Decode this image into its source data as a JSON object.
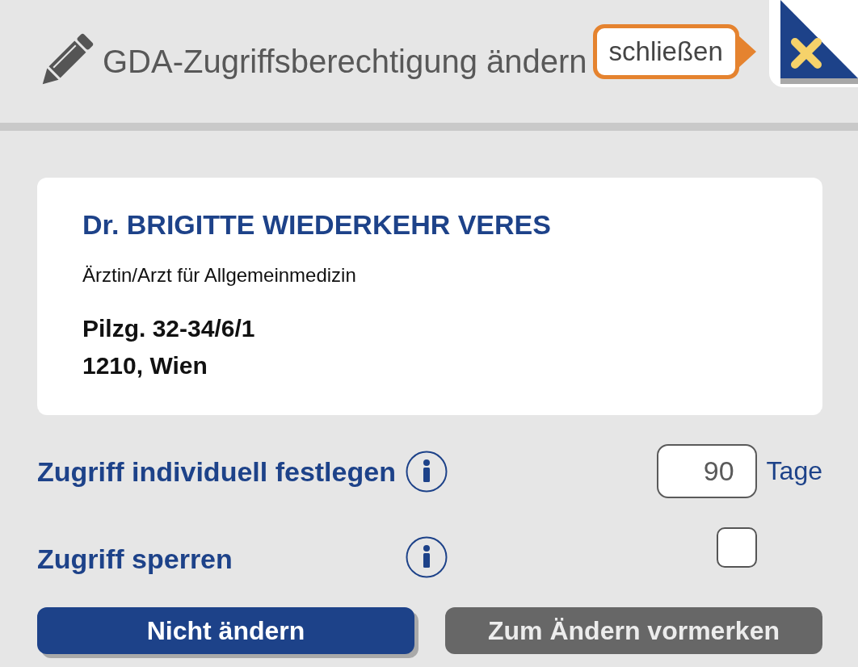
{
  "header": {
    "title": "GDA-Zugriffsberechtigung ändern",
    "close_tooltip": "schließen"
  },
  "provider": {
    "name": "Dr. BRIGITTE WIEDERKEHR VERES",
    "specialty": "Ärztin/Arzt für Allgemeinmedizin",
    "address_lines": [
      "Pilzg. 32-34/6/1",
      "1210, Wien"
    ]
  },
  "options": [
    {
      "kind": "duration",
      "label": "Zugriff individuell festlegen",
      "value": "90",
      "unit": "Tage"
    },
    {
      "kind": "checkbox",
      "label": "Zugriff sperren",
      "checked": false
    }
  ],
  "buttons": [
    {
      "kind": "primary",
      "label": "Nicht ändern"
    },
    {
      "kind": "secondary",
      "label": "Zum Ändern vormerken"
    }
  ]
}
